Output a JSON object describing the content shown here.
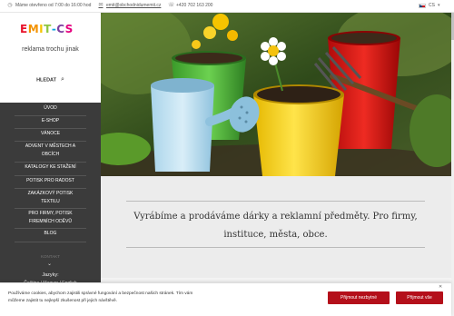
{
  "topbar": {
    "hours": "Máme otevřeno od 7:00 do 16:00 hod",
    "email": "emit@obchodnidumemit.cz",
    "phone": "+420 702 163 200",
    "language": "CS"
  },
  "brand": {
    "logo_text": "EMIT-CS",
    "tagline": "reklama trochu jinak",
    "logo_colors": [
      "#e8132b",
      "#f39200",
      "#f6c400",
      "#8dc63f",
      "#00a3e0",
      "#7b3fa0",
      "#e5007e"
    ]
  },
  "search": {
    "label": "HLEDAT"
  },
  "nav": {
    "items": [
      {
        "label": "ÚVOD"
      },
      {
        "label": "E-SHOP"
      },
      {
        "label": "VÁNOCE"
      },
      {
        "label": "ADVENT V MĚSTECH A OBCÍCH"
      },
      {
        "label": "KATALOGY KE STAŽENÍ"
      },
      {
        "label": "POTISK PRO RADOST"
      },
      {
        "label": "ZAKÁZKOVÝ POTISK TEXTILU"
      },
      {
        "label": "PRO FIRMY, POTISK FIREMNÍCH ODĚVŮ"
      },
      {
        "label": "BLOG"
      }
    ],
    "more_label": "KONTAKT",
    "languages_label": "Jazyky:",
    "languages": [
      "Čeština",
      "Magyar",
      "English"
    ]
  },
  "slogan": {
    "line1": "Vyrábíme a prodáváme dárky a reklamní předměty. Pro firmy,",
    "line2": "instituce, města, obce."
  },
  "cookie": {
    "text_line1": "Používáme cookies, abychom zajistili správné fungování a bezpečnost našich stránek. Tím vám",
    "text_line2": "můžeme zajistit tu nejlepší zkušenost při jejich návštěvě.",
    "reject_label": "Přijmout nezbytné",
    "accept_label": "Přijmout vše",
    "accent_color": "#b40f1a"
  }
}
